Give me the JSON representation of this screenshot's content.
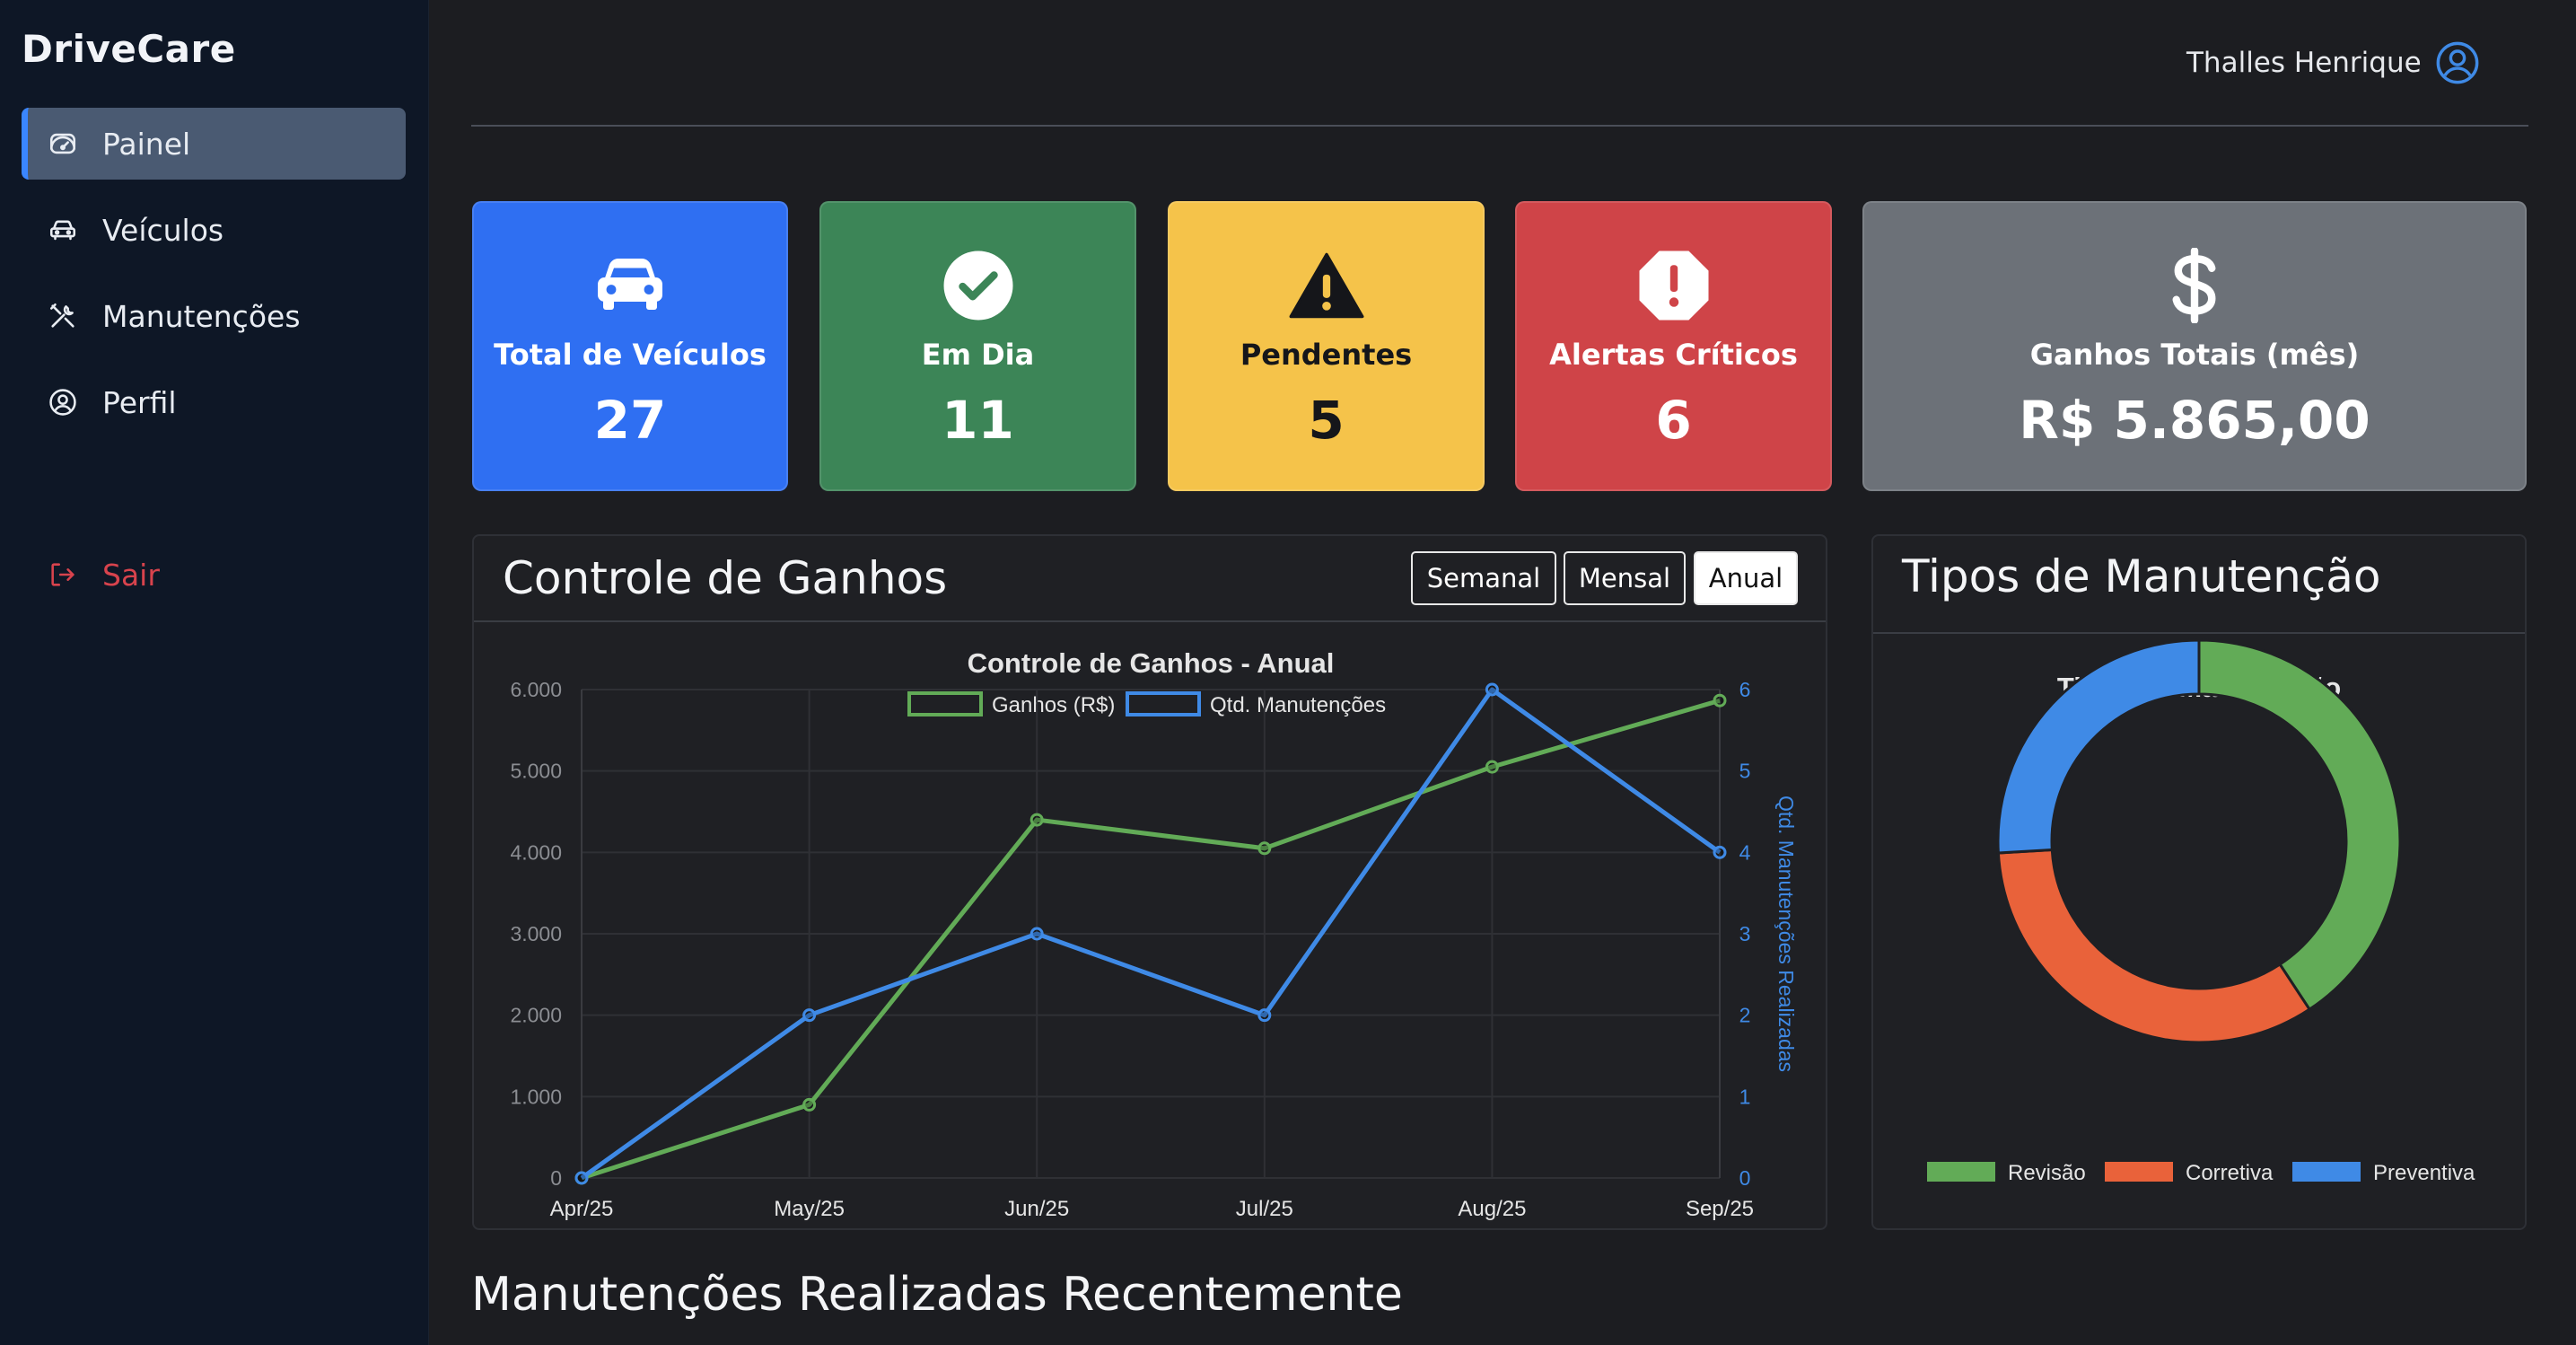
{
  "sidebar": {
    "brand": "DriveCare",
    "items": [
      {
        "label": "Painel",
        "icon": "gauge-icon"
      },
      {
        "label": "Veículos",
        "icon": "car-icon"
      },
      {
        "label": "Manutenções",
        "icon": "tools-icon"
      },
      {
        "label": "Perfil",
        "icon": "user-circle-icon"
      }
    ],
    "logout": {
      "label": "Sair",
      "icon": "logout-icon"
    }
  },
  "header": {
    "user_name": "Thalles Henrique",
    "avatar_icon": "user-circle-icon"
  },
  "stats": [
    {
      "title": "Total de Veículos",
      "value": "27",
      "icon": "car-icon",
      "color": "#2f6ff2"
    },
    {
      "title": "Em Dia",
      "value": "11",
      "icon": "check-circle-icon",
      "color": "#3c8557"
    },
    {
      "title": "Pendentes",
      "value": "5",
      "icon": "warning-triangle-icon",
      "color": "#f5c34a"
    },
    {
      "title": "Alertas Críticos",
      "value": "6",
      "icon": "alert-octagon-icon",
      "color": "#cf4448"
    },
    {
      "title": "Ganhos Totais (mês)",
      "value": "R$ 5.865,00",
      "icon": "dollar-icon",
      "color": "#6c7178"
    }
  ],
  "earnings_panel": {
    "title": "Controle de Ganhos",
    "filters": [
      "Semanal",
      "Mensal",
      "Anual"
    ],
    "active_filter": "Anual"
  },
  "types_panel": {
    "title": "Tipos de Manutenção"
  },
  "recent_heading": "Manutenções Realizadas Recentemente",
  "chart_data": [
    {
      "type": "line",
      "title": "Controle de Ganhos - Anual",
      "categories": [
        "Apr/25",
        "May/25",
        "Jun/25",
        "Jul/25",
        "Aug/25",
        "Sep/25"
      ],
      "series": [
        {
          "name": "Ganhos (R$)",
          "values": [
            0,
            900,
            4400,
            4050,
            5050,
            5865
          ],
          "color": "#62ab57",
          "axis": "left"
        },
        {
          "name": "Qtd. Manutenções",
          "values": [
            0,
            2,
            3,
            2,
            6,
            4
          ],
          "color": "#3f8ae6",
          "axis": "right"
        }
      ],
      "y_left": {
        "ticks": [
          "0",
          "1.000",
          "2.000",
          "3.000",
          "4.000",
          "5.000",
          "6.000"
        ],
        "range": [
          0,
          6000
        ]
      },
      "y_right": {
        "label": "Qtd. Manutenções Realizadas",
        "ticks": [
          "0",
          "1",
          "2",
          "3",
          "4",
          "5",
          "6"
        ],
        "range": [
          0,
          6
        ]
      },
      "legend": "top",
      "grid": true
    },
    {
      "type": "pie",
      "variant": "doughnut",
      "title": "Tipos de Manutenção",
      "labels": [
        "Revisão",
        "Corretiva",
        "Preventiva"
      ],
      "values": [
        11,
        9,
        7
      ],
      "colors": [
        "#62ab57",
        "#e9623a",
        "#3f8ae6"
      ],
      "legend": "bottom"
    }
  ]
}
